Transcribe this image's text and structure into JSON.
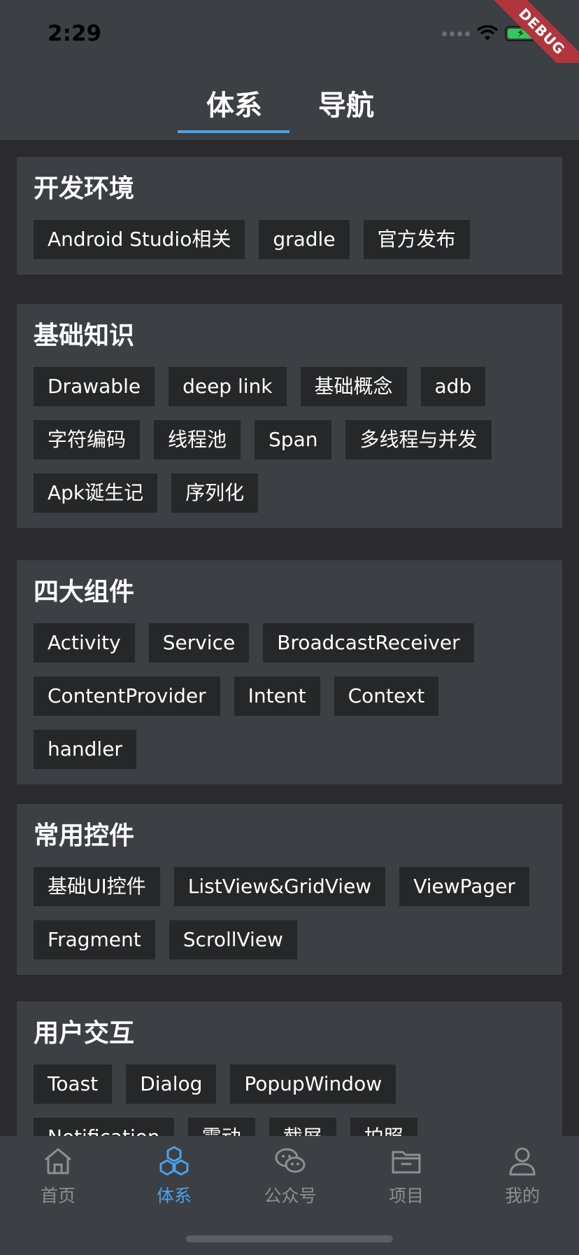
{
  "status": {
    "time": "2:29"
  },
  "debug_banner": "DEBUG",
  "tabs": [
    "体系",
    "导航"
  ],
  "sections": [
    {
      "title": "开发环境",
      "chips": [
        "Android Studio相关",
        "gradle",
        "官方发布"
      ]
    },
    {
      "title": "基础知识",
      "chips": [
        "Drawable",
        "deep link",
        "基础概念",
        "adb",
        "字符编码",
        "线程池",
        "Span",
        "多线程与并发",
        "Apk诞生记",
        "序列化"
      ]
    },
    {
      "title": "四大组件",
      "chips": [
        "Activity",
        "Service",
        "BroadcastReceiver",
        "ContentProvider",
        "Intent",
        "Context",
        "handler"
      ]
    },
    {
      "title": "常用控件",
      "chips": [
        "基础UI控件",
        "ListView&GridView",
        "ViewPager",
        "Fragment",
        "ScrollView"
      ]
    },
    {
      "title": "用户交互",
      "chips": [
        "Toast",
        "Dialog",
        "PopupWindow",
        "Notification",
        "震动",
        "截屏",
        "拍照"
      ]
    }
  ],
  "bottom_nav": [
    {
      "label": "首页",
      "icon": "home-icon",
      "active": false
    },
    {
      "label": "体系",
      "icon": "system-icon",
      "active": true
    },
    {
      "label": "公众号",
      "icon": "wechat-icon",
      "active": false
    },
    {
      "label": "项目",
      "icon": "folder-icon",
      "active": false
    },
    {
      "label": "我的",
      "icon": "user-icon",
      "active": false
    }
  ],
  "colors": {
    "accent": "#4aa3e8",
    "card": "#3c3f43",
    "chip": "#262729",
    "background": "#2b2b2d"
  }
}
